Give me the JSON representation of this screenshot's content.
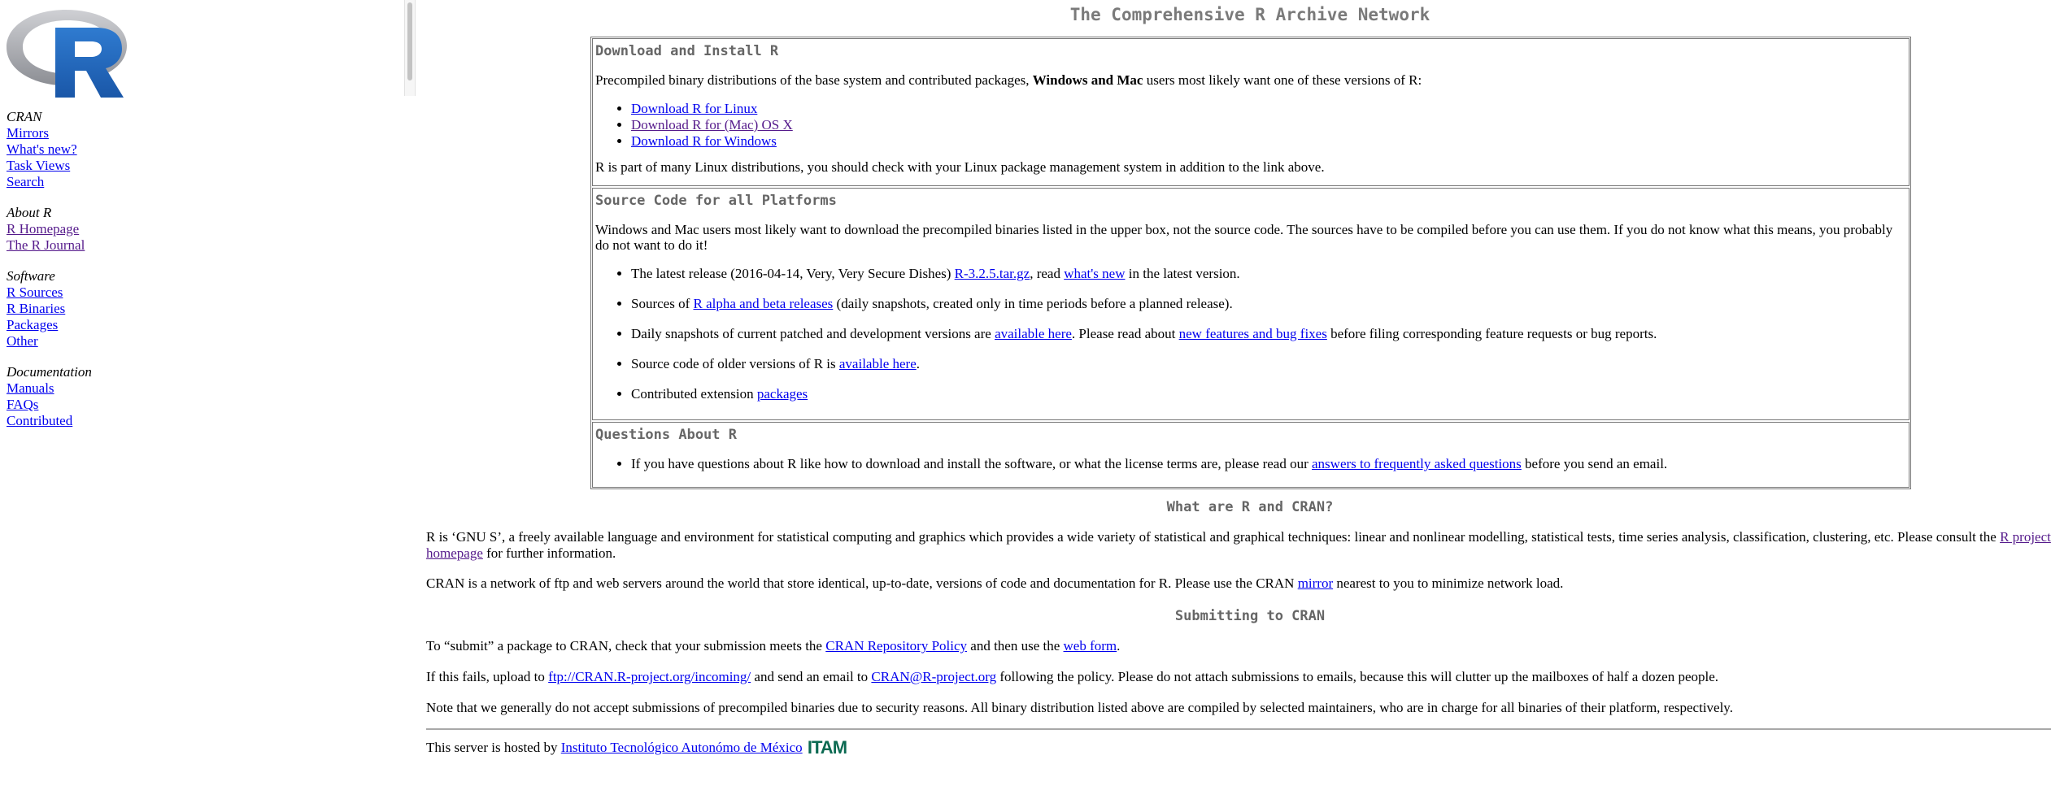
{
  "left": {
    "logo_label": "R",
    "groups": [
      {
        "header": "CRAN",
        "links": [
          "Mirrors",
          "What's new?",
          "Task Views",
          "Search"
        ]
      },
      {
        "header": "About R",
        "links": [
          "R Homepage",
          "The R Journal"
        ]
      },
      {
        "header": "Software",
        "links": [
          "R Sources",
          "R Binaries",
          "Packages",
          "Other"
        ]
      },
      {
        "header": "Documentation",
        "links": [
          "Manuals",
          "FAQs",
          "Contributed"
        ]
      }
    ]
  },
  "main": {
    "title": "The Comprehensive R Archive Network",
    "download": {
      "heading": "Download and Install R",
      "intro_pre": "Precompiled binary distributions of the base system and contributed packages, ",
      "intro_bold": "Windows and Mac",
      "intro_post": " users most likely want one of these versions of R:",
      "links": [
        "Download R for Linux",
        "Download R for (Mac) OS X",
        "Download R for Windows"
      ],
      "note": "R is part of many Linux distributions, you should check with your Linux package management system in addition to the link above."
    },
    "source": {
      "heading": "Source Code for all Platforms",
      "intro": "Windows and Mac users most likely want to download the precompiled binaries listed in the upper box, not the source code. The sources have to be compiled before you can use them. If you do not know what this means, you probably do not want to do it!",
      "items": {
        "latest_pre": "The latest release (2016-04-14, Very, Very Secure Dishes) ",
        "latest_link": "R-3.2.5.tar.gz",
        "latest_mid": ", read ",
        "latest_link2": "what's new",
        "latest_post": " in the latest version.",
        "alpha_pre": "Sources of ",
        "alpha_link": "R alpha and beta releases",
        "alpha_post": " (daily snapshots, created only in time periods before a planned release).",
        "daily_pre": "Daily snapshots of current patched and development versions are ",
        "daily_link": "available here",
        "daily_mid": ". Please read about ",
        "daily_link2": "new features and bug fixes",
        "daily_post": " before filing corresponding feature requests or bug reports.",
        "older_pre": "Source code of older versions of R is ",
        "older_link": "available here",
        "older_post": ".",
        "contrib_pre": "Contributed extension ",
        "contrib_link": "packages"
      }
    },
    "questions": {
      "heading": "Questions About R",
      "item_pre": "If you have questions about R like how to download and install the software, or what the license terms are, please read our ",
      "item_link": "answers to frequently asked questions",
      "item_post": " before you send an email."
    },
    "what": {
      "heading": "What are R and CRAN?",
      "p1_pre": "R is ‘GNU S’, a freely available language and environment for statistical computing and graphics which provides a wide variety of statistical and graphical techniques: linear and nonlinear modelling, statistical tests, time series analysis, classification, clustering, etc. Please consult the ",
      "p1_link": "R project homepage",
      "p1_post": " for further information.",
      "p2_pre": "CRAN is a network of ftp and web servers around the world that store identical, up-to-date, versions of code and documentation for R. Please use the CRAN ",
      "p2_link": "mirror",
      "p2_post": " nearest to you to minimize network load."
    },
    "submit": {
      "heading": "Submitting to CRAN",
      "p1_pre": "To “submit” a package to CRAN, check that your submission meets the ",
      "p1_link": "CRAN Repository Policy",
      "p1_mid": " and then use the ",
      "p1_link2": "web form",
      "p1_post": ".",
      "p2_pre": "If this fails, upload to ",
      "p2_link": "ftp://CRAN.R-project.org/incoming/",
      "p2_mid": " and send an email to ",
      "p2_link2": "CRAN@R-project.org",
      "p2_post": " following the policy. Please do not attach submissions to emails, because this will clutter up the mailboxes of half a dozen people.",
      "p3": "Note that we generally do not accept submissions of precompiled binaries due to security reasons. All binary distribution listed above are compiled by selected maintainers, who are in charge for all binaries of their platform, respectively."
    },
    "footer": {
      "pre": "This server is hosted by ",
      "link": "Instituto Tecnológico Autonómo de México",
      "logo_text": "ITAM"
    }
  },
  "colors": {
    "link": "#0000ee",
    "visited": "#551a8b",
    "heading": "#666666",
    "r_logo_blue": "#2266b8",
    "itam_green": "#0b6a52"
  }
}
